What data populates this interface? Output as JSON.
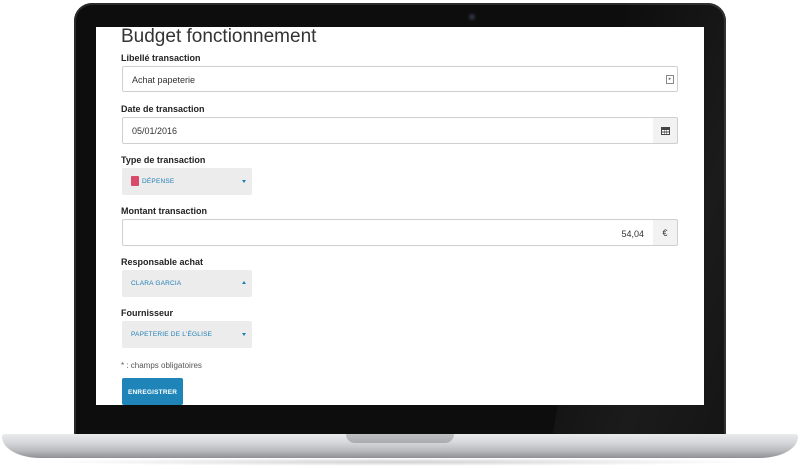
{
  "page": {
    "title": "Budget fonctionnement"
  },
  "form": {
    "libelle": {
      "label": "Libellé transaction",
      "value": "Achat papeterie",
      "icon": "text-field-icon"
    },
    "date": {
      "label": "Date de transaction",
      "value": "05/01/2016",
      "icon": "calendar-icon"
    },
    "type": {
      "label": "Type de transaction",
      "value": "DÉPENSE",
      "swatch_color": "#d94a6a",
      "icon": "chevron-down-icon"
    },
    "montant": {
      "label": "Montant transaction",
      "value": "54,04",
      "currency": "€"
    },
    "responsable": {
      "label": "Responsable achat",
      "value": "CLARA GARCIA",
      "icon": "chevron-up-icon"
    },
    "fournisseur": {
      "label": "Fournisseur",
      "value": "PAPETERIE DE L'ÉGLISE",
      "icon": "chevron-down-icon"
    },
    "required_note": "* : champs obligatoires",
    "submit_label": "ENREGISTRER"
  },
  "theme": {
    "accent": "#1f85b8",
    "link": "#1f7fb5",
    "laptop_bezel": "#0d0d0d"
  }
}
